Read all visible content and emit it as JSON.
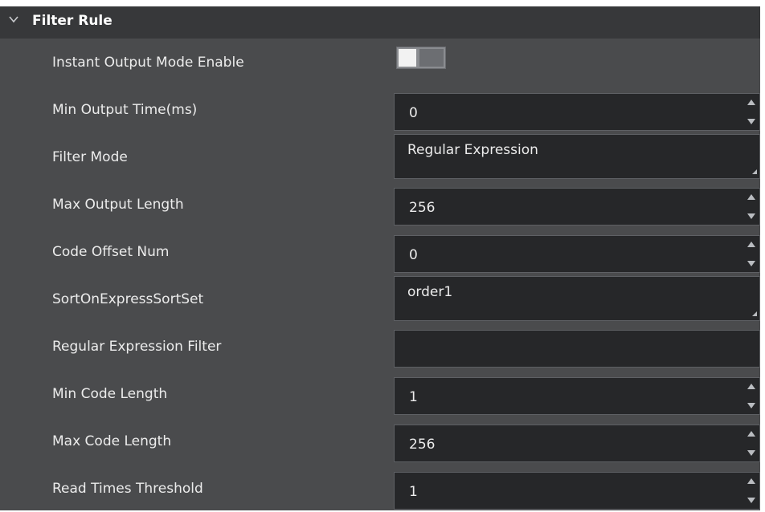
{
  "section": {
    "title": "Filter Rule",
    "chevron_icon": "chevron-down-icon"
  },
  "rows": {
    "instant_output": {
      "label": "Instant Output Mode Enable",
      "enabled": false
    },
    "min_output_time": {
      "label": "Min Output Time(ms)",
      "value": "0"
    },
    "filter_mode": {
      "label": "Filter Mode",
      "value": "Regular Expression"
    },
    "max_output_length": {
      "label": "Max Output Length",
      "value": "256"
    },
    "code_offset_num": {
      "label": "Code Offset Num",
      "value": "0"
    },
    "sort_set": {
      "label": "SortOnExpressSortSet",
      "value": "order1"
    },
    "regex_filter": {
      "label": "Regular Expression Filter",
      "value": ""
    },
    "min_code_length": {
      "label": "Min Code Length",
      "value": "1"
    },
    "max_code_length": {
      "label": "Max Code Length",
      "value": "256"
    },
    "read_times_threshold": {
      "label": "Read Times Threshold",
      "value": "1"
    }
  },
  "colors": {
    "panel_bg": "#4a4b4d",
    "header_bg": "#37383a",
    "field_bg": "#262729",
    "text": "#ececec"
  }
}
